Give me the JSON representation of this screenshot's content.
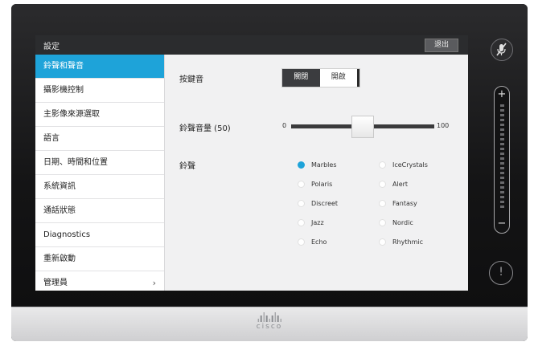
{
  "header": {
    "title": "設定",
    "exit_label": "退出"
  },
  "sidebar": {
    "items": [
      {
        "label": "鈴聲和聲音",
        "active": true
      },
      {
        "label": "攝影機控制"
      },
      {
        "label": "主影像來源選取"
      },
      {
        "label": "語言"
      },
      {
        "label": "日期、時間和位置"
      },
      {
        "label": "系統資訊"
      },
      {
        "label": "通話狀態"
      },
      {
        "label": "Diagnostics"
      },
      {
        "label": "重新啟動"
      },
      {
        "label": "管理員"
      }
    ]
  },
  "keytones": {
    "label": "按鍵音",
    "off_label": "關閉",
    "on_label": "開啟",
    "selected": "off"
  },
  "ringtone_volume": {
    "label": "鈴聲音量 (50)",
    "min_label": "0",
    "max_label": "100",
    "value": 50
  },
  "ringtone": {
    "label": "鈴聲",
    "options_left": [
      "Marbles",
      "Polaris",
      "Discreet",
      "Jazz",
      "Echo"
    ],
    "options_right": [
      "IceCrystals",
      "Alert",
      "Fantasy",
      "Nordic",
      "Rhythmic"
    ],
    "selected": "Marbles"
  },
  "device": {
    "brand": "cisco",
    "icons": [
      "mute-icon",
      "volume-plus-icon",
      "volume-minus-icon",
      "alert-icon"
    ],
    "accent_color": "#1ea3d9"
  }
}
